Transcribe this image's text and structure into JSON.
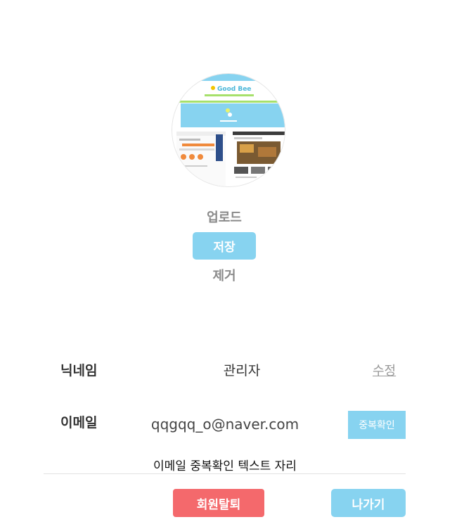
{
  "profile_image": {
    "alt_logo_text": "Good Bee",
    "accent": "#87d3f0"
  },
  "image_actions": {
    "upload_label": "업로드",
    "save_label": "저장",
    "remove_label": "제거"
  },
  "nickname": {
    "label": "닉네임",
    "value": "관리자",
    "edit_label": "수정"
  },
  "email": {
    "label": "이메일",
    "value": "qqgqq_o@naver.com",
    "check_button_label": "중복확인",
    "check_message": "이메일 중복확인 텍스트 자리"
  },
  "footer": {
    "withdraw_label": "회원탈퇴",
    "exit_label": "나가기"
  },
  "colors": {
    "primary": "#87d3f0",
    "danger": "#f4696c",
    "muted_text": "#8a8a8a"
  }
}
